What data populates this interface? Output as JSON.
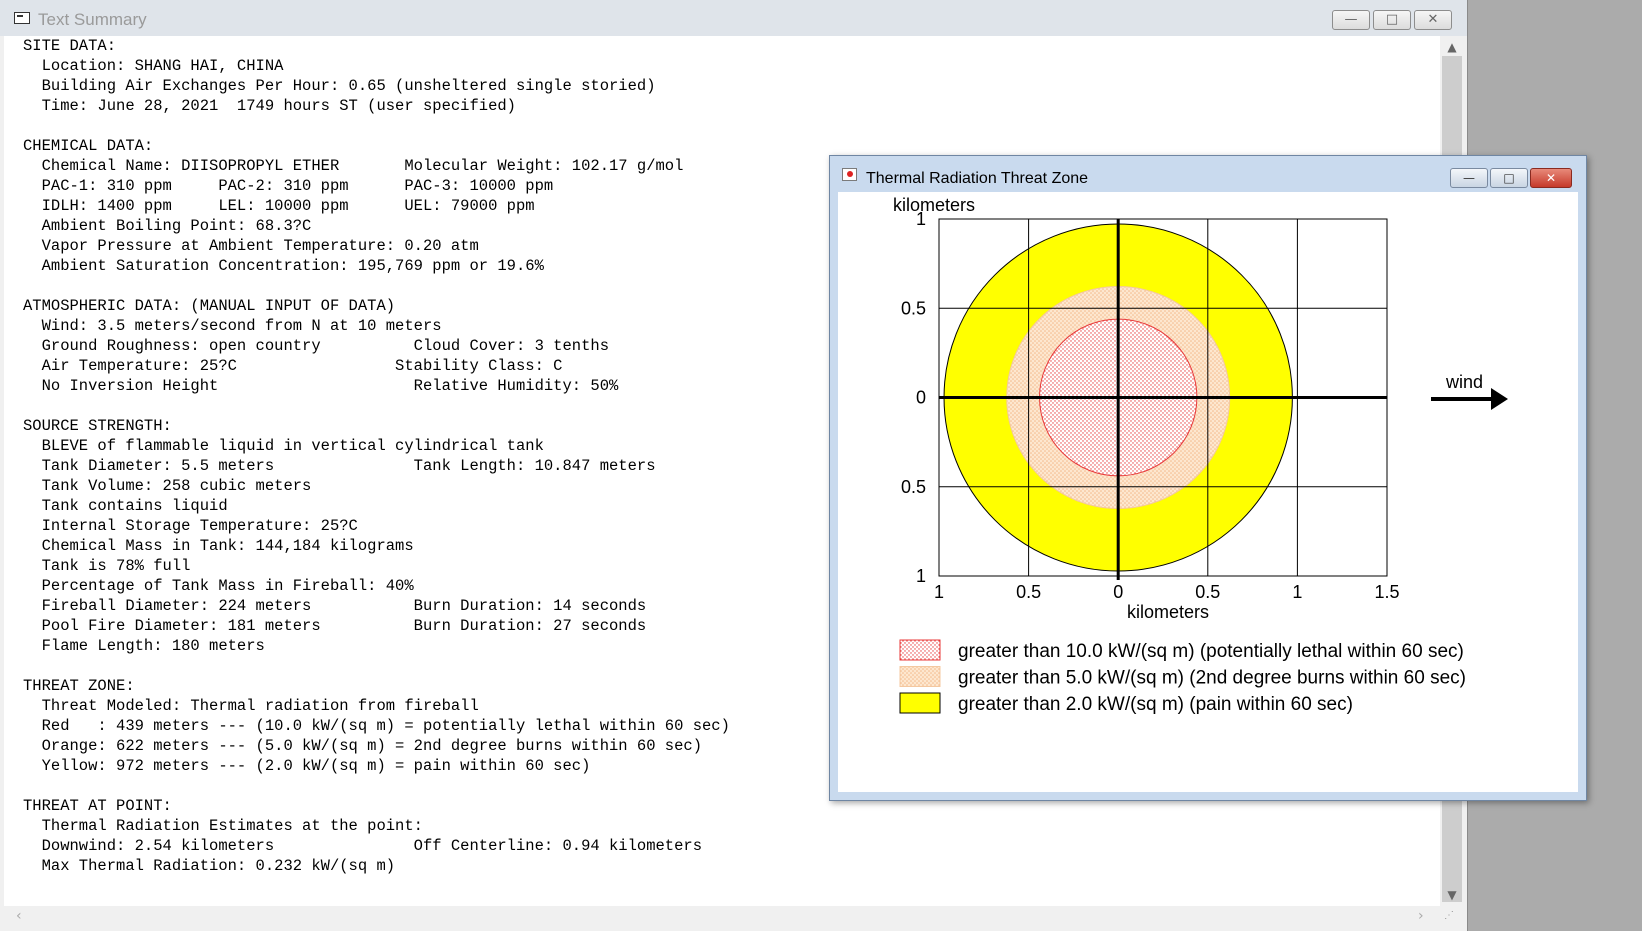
{
  "text_summary": {
    "title": "Text Summary",
    "controls": {
      "minimize": "—",
      "maximize": "□",
      "close": "✕"
    },
    "lines": [
      "SITE DATA:",
      "  Location: SHANG HAI, CHINA",
      "  Building Air Exchanges Per Hour: 0.65 (unsheltered single storied)",
      "  Time: June 28, 2021  1749 hours ST (user specified)",
      "",
      "CHEMICAL DATA:",
      "  Chemical Name: DIISOPROPYL ETHER       Molecular Weight: 102.17 g/mol",
      "  PAC-1: 310 ppm     PAC-2: 310 ppm      PAC-3: 10000 ppm",
      "  IDLH: 1400 ppm     LEL: 10000 ppm      UEL: 79000 ppm",
      "  Ambient Boiling Point: 68.3?C",
      "  Vapor Pressure at Ambient Temperature: 0.20 atm",
      "  Ambient Saturation Concentration: 195,769 ppm or 19.6%",
      "",
      "ATMOSPHERIC DATA: (MANUAL INPUT OF DATA)",
      "  Wind: 3.5 meters/second from N at 10 meters",
      "  Ground Roughness: open country          Cloud Cover: 3 tenths",
      "  Air Temperature: 25?C                 Stability Class: C",
      "  No Inversion Height                     Relative Humidity: 50%",
      "",
      "SOURCE STRENGTH:",
      "  BLEVE of flammable liquid in vertical cylindrical tank",
      "  Tank Diameter: 5.5 meters               Tank Length: 10.847 meters",
      "  Tank Volume: 258 cubic meters",
      "  Tank contains liquid",
      "  Internal Storage Temperature: 25?C",
      "  Chemical Mass in Tank: 144,184 kilograms",
      "  Tank is 78% full",
      "  Percentage of Tank Mass in Fireball: 40%",
      "  Fireball Diameter: 224 meters           Burn Duration: 14 seconds",
      "  Pool Fire Diameter: 181 meters          Burn Duration: 27 seconds",
      "  Flame Length: 180 meters",
      "",
      "THREAT ZONE:",
      "  Threat Modeled: Thermal radiation from fireball",
      "  Red   : 439 meters --- (10.0 kW/(sq m) = potentially lethal within 60 sec)",
      "  Orange: 622 meters --- (5.0 kW/(sq m) = 2nd degree burns within 60 sec)",
      "  Yellow: 972 meters --- (2.0 kW/(sq m) = pain within 60 sec)",
      "",
      "THREAT AT POINT:",
      "  Thermal Radiation Estimates at the point:",
      "  Downwind: 2.54 kilometers               Off Centerline: 0.94 kilometers",
      "  Max Thermal Radiation: 0.232 kW/(sq m)"
    ]
  },
  "threat_zone_window": {
    "title": "Thermal Radiation Threat Zone",
    "controls": {
      "minimize": "—",
      "maximize": "□",
      "close": "✕"
    },
    "wind_label": "wind",
    "colors": {
      "red": "#e83a3a",
      "red_fill": "#fbe3e3",
      "orange": "#f4b98a",
      "orange_fill": "#fbe0c4",
      "yellow": "#ffff00"
    }
  },
  "chart_data": {
    "type": "area",
    "ylabel": "kilometers",
    "xlabel": "kilometers",
    "x_tick_labels": [
      "1",
      "0.5",
      "0",
      "0.5",
      "1",
      "1.5"
    ],
    "y_tick_labels": [
      "1",
      "0.5",
      "0",
      "0.5",
      "1"
    ],
    "xlim": [
      -1,
      1.5
    ],
    "ylim": [
      -1,
      1
    ],
    "grid": true,
    "zones": [
      {
        "name": "greater than 10.0 kW/(sq m) (potentially lethal within 60 sec)",
        "radius_km": 0.439,
        "color": "#e83a3a",
        "pattern": "red-dots"
      },
      {
        "name": "greater than 5.0 kW/(sq m) (2nd degree burns within 60 sec)",
        "radius_km": 0.622,
        "color": "#fbd8b4",
        "pattern": "orange-dots"
      },
      {
        "name": "greater than 2.0 kW/(sq m) (pain within 60 sec)",
        "radius_km": 0.972,
        "color": "#ffff00",
        "pattern": "solid"
      }
    ]
  }
}
